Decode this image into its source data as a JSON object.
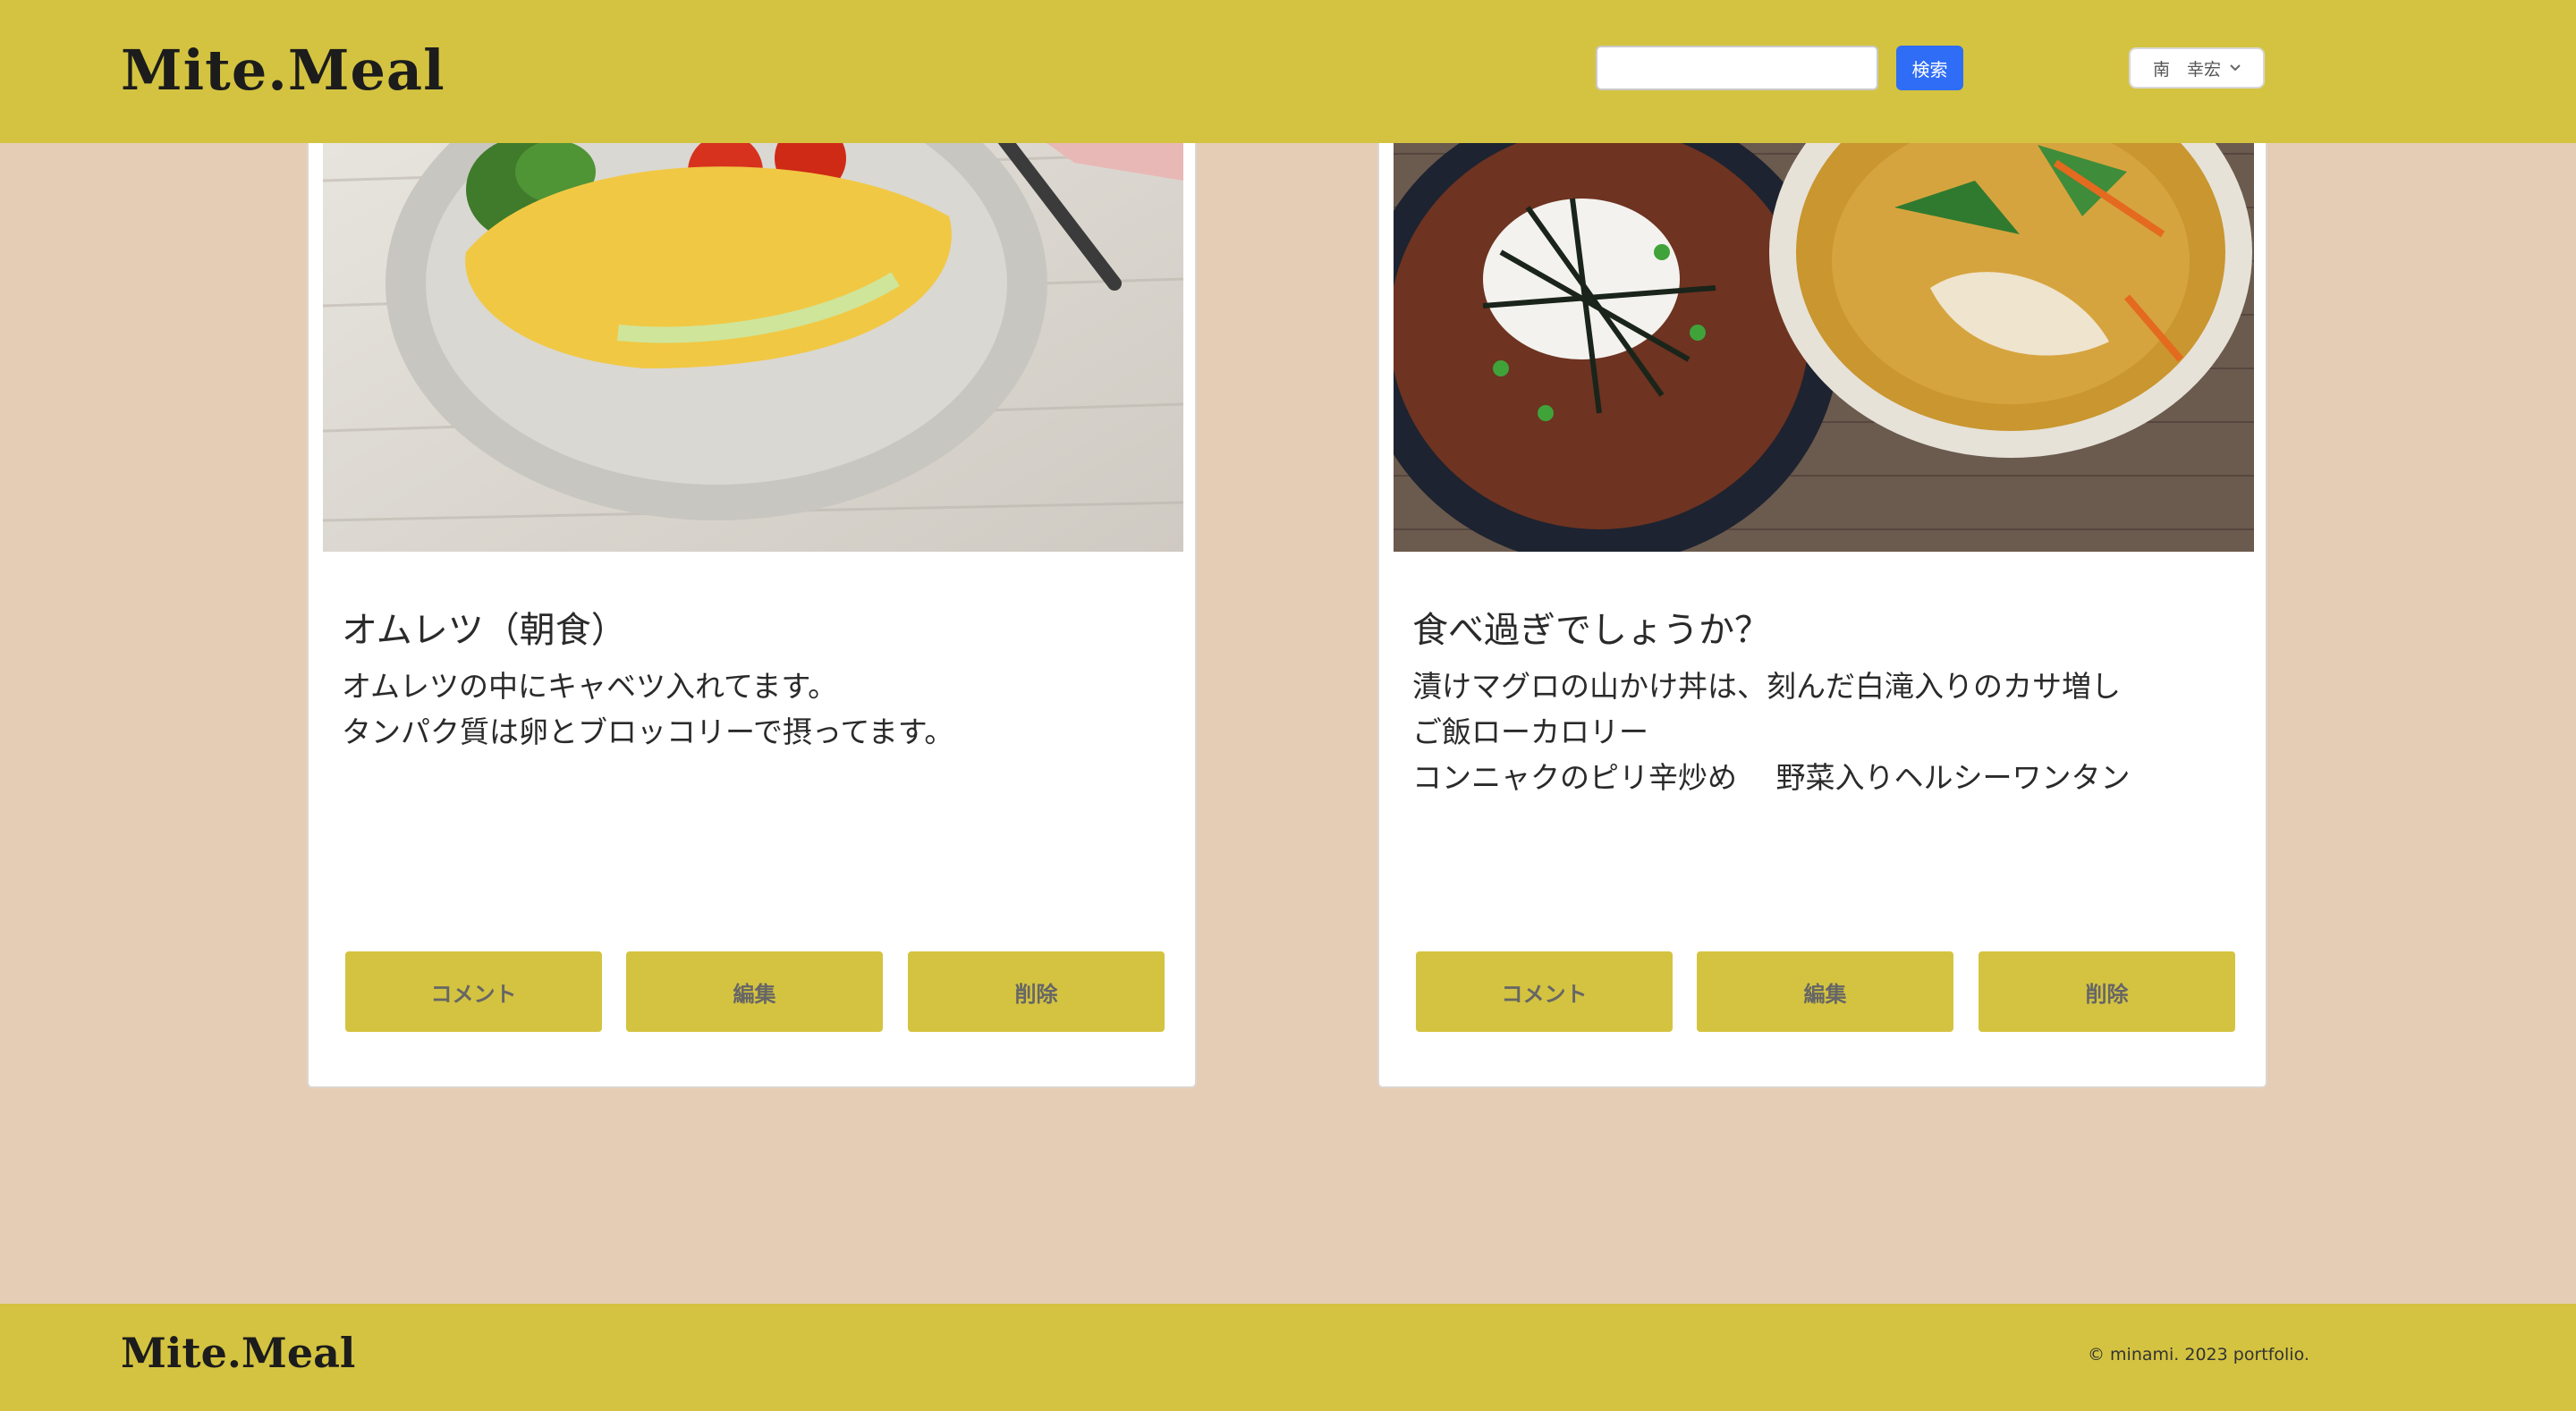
{
  "header": {
    "logo": "Mite.Meal",
    "search_placeholder": "",
    "search_button": "検索",
    "user_name": "南　幸宏"
  },
  "posts": [
    {
      "title": "オムレツ（朝食）",
      "body_lines": [
        "オムレツの中にキャベツ入れてます。",
        "タンパク質は卵とブロッコリーで摂ってます。"
      ],
      "buttons": {
        "comment": "コメント",
        "edit": "編集",
        "delete": "削除"
      }
    },
    {
      "title": "食べ過ぎでしょうか？",
      "body_lines": [
        "漬けマグロの山かけ丼は、刻んだ白滝入りのカサ増し",
        "ご飯ローカロリー",
        "コンニャクのピリ辛炒め　 野菜入りヘルシーワンタン"
      ],
      "buttons": {
        "comment": "コメント",
        "edit": "編集",
        "delete": "削除"
      }
    }
  ],
  "footer": {
    "logo": "Mite.Meal",
    "copyright": "© minami. 2023 portfolio."
  },
  "colors": {
    "page_background": "#e5cdb5",
    "brand_yellow": "#d4c340",
    "search_button_blue": "#2f6df6"
  },
  "icons": {
    "user_menu_caret": "chevron-down-icon"
  }
}
